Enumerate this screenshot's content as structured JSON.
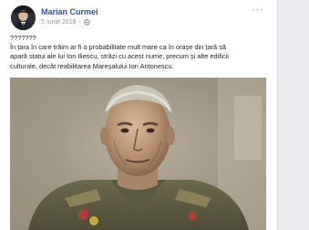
{
  "post": {
    "author": "Marian Curmei",
    "date": "5 Iunie 2018",
    "separator": "·",
    "privacy_icon": "globe-icon",
    "more_icon": "more-options-icon",
    "more_label": "···",
    "text_lines": [
      "???????",
      "În țara în care trăim ar fi o probabilitate mult mare ca în orașe din țară să",
      "apară statui ale lui Ion Iliescu, străzi cu acest nume, precum și alte edificii",
      "culturale, decât reabilitarea Mareșalului Ion Antonescu."
    ],
    "image_subject": "painted-portrait-of-a-uniformed-officer"
  },
  "colors": {
    "author_link": "#385898",
    "meta_text": "#90949c",
    "body_text": "#1d2129",
    "page_background": "#e9ebee",
    "card_background": "#ffffff"
  }
}
